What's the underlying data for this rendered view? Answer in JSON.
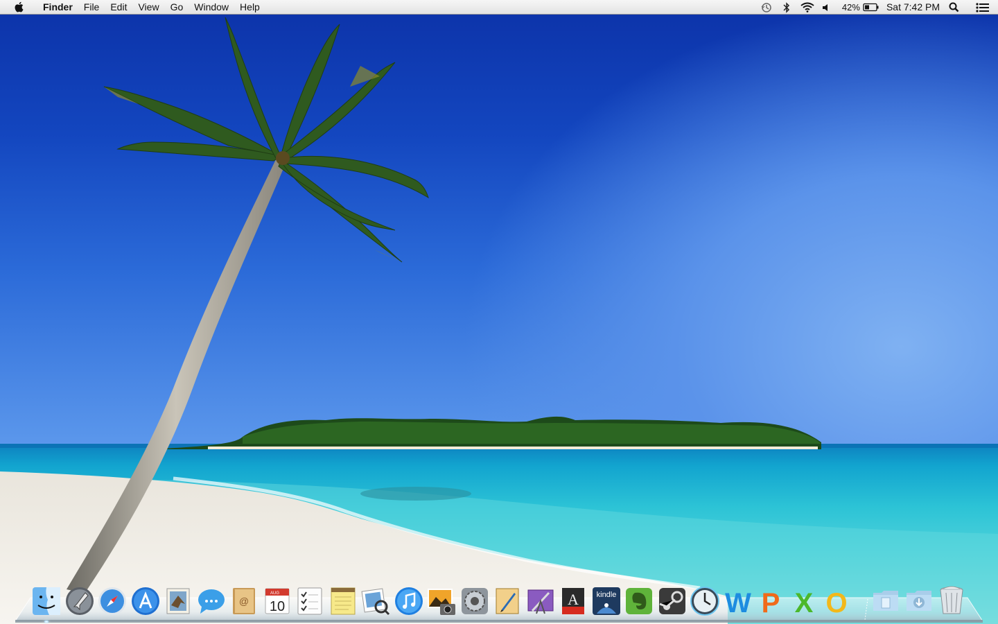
{
  "menubar": {
    "apple_icon": "apple-logo-icon",
    "app_name": "Finder",
    "menus": [
      "File",
      "Edit",
      "View",
      "Go",
      "Window",
      "Help"
    ],
    "status": {
      "time_machine_icon": "time-machine-icon",
      "bluetooth_icon": "bluetooth-icon",
      "wifi_icon": "wifi-icon",
      "volume_icon": "volume-icon",
      "battery_percent": "42%",
      "battery_icon": "battery-icon",
      "clock": "Sat 7:42 PM",
      "spotlight_icon": "spotlight-search-icon",
      "notification_icon": "notification-center-icon"
    }
  },
  "dock": {
    "apps": [
      {
        "name": "Finder",
        "icon": "finder-icon",
        "running": true
      },
      {
        "name": "Launchpad",
        "icon": "launchpad-icon",
        "running": false
      },
      {
        "name": "Safari",
        "icon": "safari-icon",
        "running": false
      },
      {
        "name": "App Store",
        "icon": "app-store-icon",
        "running": false
      },
      {
        "name": "Mail",
        "icon": "mail-icon",
        "running": false
      },
      {
        "name": "Messages",
        "icon": "messages-icon",
        "running": false
      },
      {
        "name": "Contacts",
        "icon": "contacts-icon",
        "running": false
      },
      {
        "name": "Calendar",
        "icon": "calendar-icon",
        "running": false,
        "month": "AUG",
        "day": "10"
      },
      {
        "name": "Reminders",
        "icon": "reminders-icon",
        "running": false
      },
      {
        "name": "Notes",
        "icon": "notes-icon",
        "running": false
      },
      {
        "name": "Preview",
        "icon": "preview-icon",
        "running": false
      },
      {
        "name": "iTunes",
        "icon": "itunes-icon",
        "running": false
      },
      {
        "name": "iPhoto",
        "icon": "iphoto-icon",
        "running": false
      },
      {
        "name": "System Preferences",
        "icon": "system-preferences-icon",
        "running": false
      },
      {
        "name": "Pages",
        "icon": "pages-icon",
        "running": false
      },
      {
        "name": "Keynote",
        "icon": "keynote-icon",
        "running": false
      },
      {
        "name": "Font Book",
        "icon": "font-book-icon",
        "running": false
      },
      {
        "name": "Kindle",
        "icon": "kindle-icon",
        "running": false,
        "label": "kindle"
      },
      {
        "name": "Evernote",
        "icon": "evernote-icon",
        "running": false
      },
      {
        "name": "Steam",
        "icon": "steam-icon",
        "running": false
      },
      {
        "name": "Time Machine",
        "icon": "time-machine-app-icon",
        "running": false
      },
      {
        "name": "Microsoft Word",
        "icon": "word-icon",
        "running": false,
        "letter": "W"
      },
      {
        "name": "Microsoft PowerPoint",
        "icon": "powerpoint-icon",
        "running": false,
        "letter": "P"
      },
      {
        "name": "Microsoft Excel",
        "icon": "excel-icon",
        "running": false,
        "letter": "X"
      },
      {
        "name": "Microsoft Outlook",
        "icon": "outlook-icon",
        "running": false,
        "letter": "O"
      }
    ],
    "stacks": [
      {
        "name": "Documents",
        "icon": "documents-folder-icon"
      },
      {
        "name": "Downloads",
        "icon": "downloads-folder-icon"
      },
      {
        "name": "Trash",
        "icon": "trash-icon"
      }
    ]
  },
  "colors": {
    "sky_top": "#0c32a8",
    "sky_bottom": "#5c98ec",
    "sea": "#2cc3d6",
    "sand": "#f2efe8",
    "menubar": "#ececec"
  }
}
